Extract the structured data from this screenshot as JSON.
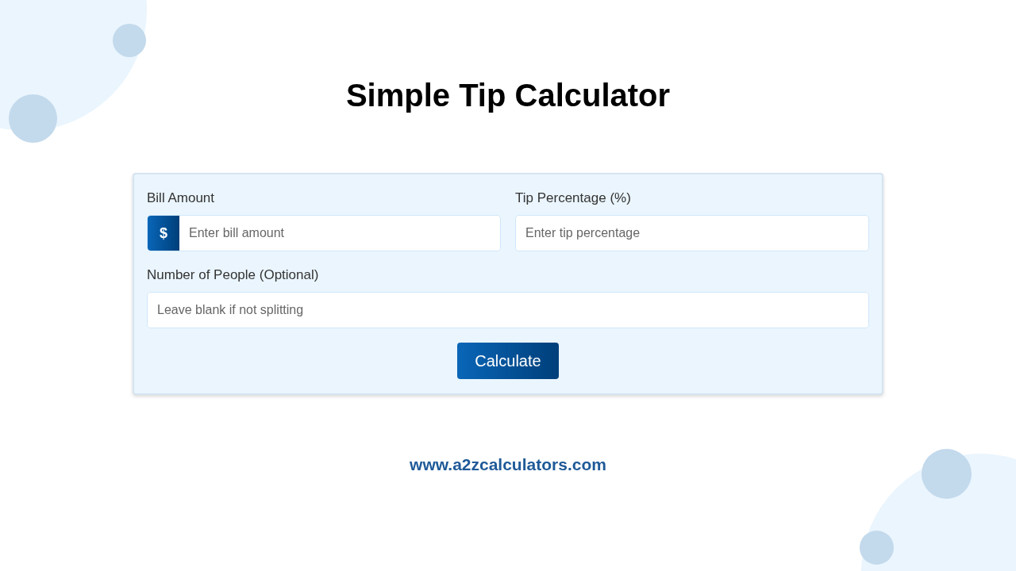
{
  "title": "Simple Tip Calculator",
  "form": {
    "rows": [
      [
        {
          "label": "Bill Amount",
          "prefix": "$",
          "placeholder": "Enter bill amount"
        },
        {
          "label": "Tip Percentage (%)",
          "placeholder": "Enter tip percentage"
        }
      ],
      [
        {
          "label": "Number of People (Optional)",
          "placeholder": "Leave blank if not splitting"
        }
      ]
    ],
    "button": "Calculate"
  },
  "footer": "www.a2zcalculators.com"
}
